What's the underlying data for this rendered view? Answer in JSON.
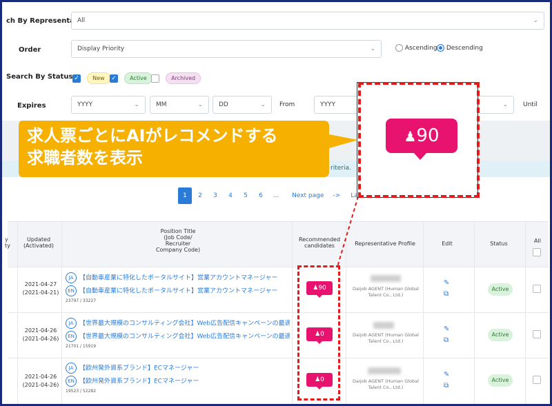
{
  "filters": {
    "representative_label": "ch By Representative",
    "representative_value": "All",
    "order_label": "Order",
    "order_value": "Display Priority",
    "ascending_label": "Ascending",
    "descending_label": "Descending",
    "status_label": "Search By Status",
    "status_new": "New",
    "status_active": "Active",
    "status_archived": "Archived",
    "expires_label": "Expires",
    "yyyy": "YYYY",
    "mm": "MM",
    "dd": "DD",
    "from": "From",
    "yyyy2": "YYYY",
    "until": "Until"
  },
  "info_text": "riteria.",
  "pagination": {
    "pages": [
      "1",
      "2",
      "3",
      "4",
      "5",
      "6",
      "..."
    ],
    "next": "Next page",
    "arrow": "->",
    "last": "Last"
  },
  "table": {
    "headers": {
      "col0": "y\nty",
      "updated": "Updated\n(Activated)",
      "position": "Position Title\n(Job Code/\nRecruiter\nCompany Code)",
      "recommended": "Recommended\ncandidates",
      "rep": "Representative Profile",
      "edit": "Edit",
      "status": "Status",
      "all": "All"
    },
    "rows": [
      {
        "date": "2021-04-27",
        "activated": "(2021-04-21)",
        "ja_title": "【自動車産業に特化したポータルサイト】営業アカウントマネージャー",
        "en_title": "【自動車産業に特化したポータルサイト】営業アカウントマネージャー",
        "code": "23797 / 33227",
        "count": "90",
        "rep_company": "Daijob AGENT (Human Global Talent Co., Ltd.)",
        "status": "Active"
      },
      {
        "date": "2021-04-26",
        "activated": "(2021-04-26)",
        "ja_title": "【世界最大規模のコンサルティング会社】Web広告配信キャンペーンの最適化",
        "en_title": "【世界最大規模のコンサルティング会社】Web広告配信キャンペーンの最適化",
        "code": "21701 / 15919",
        "count": "0",
        "rep_company": "Daijob AGENT (Human Global Talent Co., Ltd.)",
        "status": "Active"
      },
      {
        "date": "2021-04-26",
        "activated": "(2021-04-26)",
        "ja_title": "【欧州発外資系ブランド】ECマネージャー",
        "en_title": "【欧州発外資系ブランド】ECマネージャー",
        "code": "19523 / 52282",
        "count": "0",
        "rep_company": "Daijob AGENT (Human Global Talent Co., Ltd.)",
        "status": "Active"
      }
    ]
  },
  "callout": {
    "line1": "求人票ごとにAIがレコメンドする",
    "line2": "求職者数を表示",
    "zoom_count": "90"
  },
  "lang": {
    "ja": "JA",
    "en": "EN"
  },
  "colors": {
    "accent": "#2a7bd8",
    "badge": "#e8136f",
    "callout": "#f5b000",
    "highlight": "#e41a1a"
  }
}
